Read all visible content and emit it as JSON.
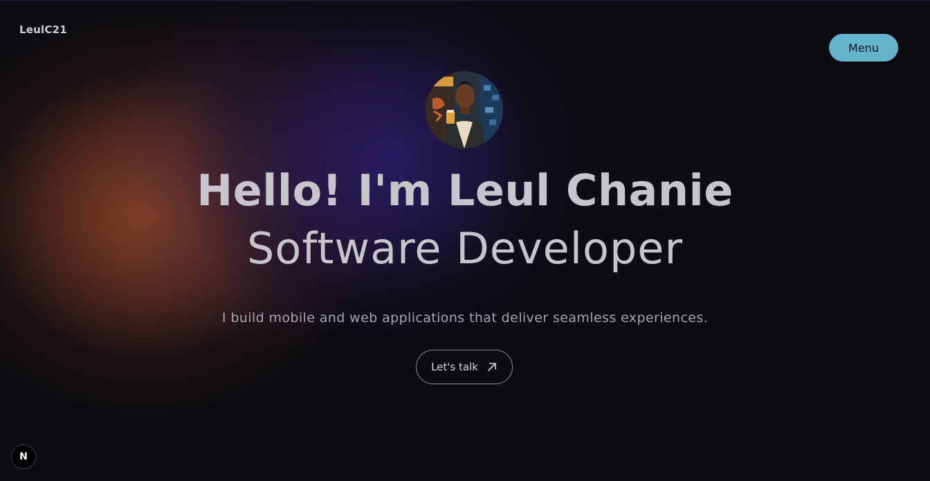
{
  "header": {
    "logo_text": "LeulC21",
    "menu_label": "Menu"
  },
  "hero": {
    "avatar_icon": "profile-avatar-illustration",
    "title": "Hello! I'm Leul Chanie",
    "subtitle": "Software Developer",
    "tagline": "I build mobile and web applications that deliver seamless experiences.",
    "cta_label": "Let's talk",
    "cta_icon": "arrow-up-right-icon"
  },
  "badge": {
    "label": "N",
    "icon": "nextjs-icon"
  },
  "colors": {
    "background": "#0d0c10",
    "accent_menu": "#63b4cc",
    "text_primary": "#c6c5cb",
    "text_secondary": "#a7a5ae",
    "glow_orange": "#8c4426",
    "glow_purple": "#2a1c64"
  }
}
